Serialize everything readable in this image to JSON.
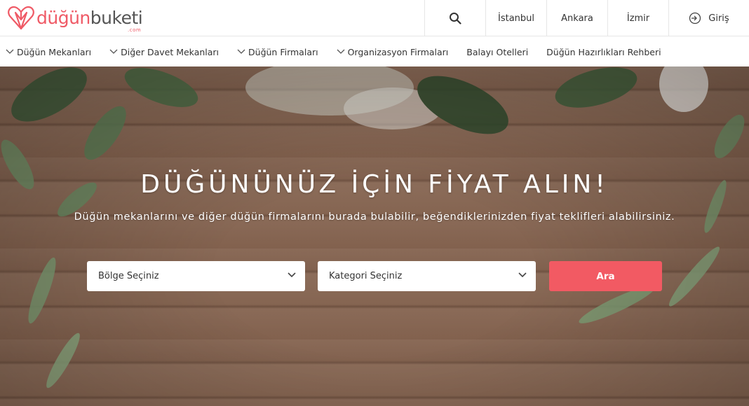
{
  "logo": {
    "part1": "düğün",
    "part2": "buketi",
    "suffix": ".com"
  },
  "topnav": {
    "cities": [
      "İstanbul",
      "Ankara",
      "İzmir"
    ],
    "login": "Giriş"
  },
  "catnav": {
    "items": [
      {
        "label": "Düğün Mekanları",
        "has_dropdown": true
      },
      {
        "label": "Diğer Davet Mekanları",
        "has_dropdown": true
      },
      {
        "label": "Düğün Firmaları",
        "has_dropdown": true
      },
      {
        "label": "Organizasyon Firmaları",
        "has_dropdown": true
      },
      {
        "label": "Balayı Otelleri",
        "has_dropdown": false
      },
      {
        "label": "Düğün Hazırlıkları Rehberi",
        "has_dropdown": false
      }
    ]
  },
  "hero": {
    "title": "DÜĞÜNÜNÜZ İÇİN FİYAT ALIN!",
    "subtitle": "Düğün mekanlarını ve diğer düğün firmalarını burada bulabilir, beğendiklerinizden fiyat teklifleri alabilirsiniz.",
    "region_select": "Bölge Seçiniz",
    "category_select": "Kategori Seçiniz",
    "search_button": "Ara"
  },
  "colors": {
    "brand": "#ef5a66",
    "button": "#f25a63"
  }
}
